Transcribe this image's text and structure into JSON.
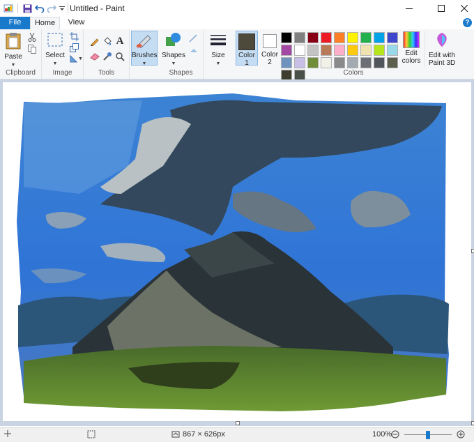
{
  "window": {
    "title": "Untitled - Paint"
  },
  "tabs": {
    "file": "File",
    "home": "Home",
    "view": "View"
  },
  "ribbon": {
    "clipboard": {
      "paste": "Paste",
      "group": "Clipboard"
    },
    "image": {
      "select": "Select",
      "group": "Image"
    },
    "tools": {
      "group": "Tools",
      "text_glyph": "A"
    },
    "brushes": {
      "label": "Brushes"
    },
    "shapes": {
      "label": "Shapes",
      "group": "Shapes"
    },
    "size": {
      "label": "Size"
    },
    "colors": {
      "color1_line1": "Color",
      "color1_line2": "1",
      "color2_line1": "Color",
      "color2_line2": "2",
      "edit_line1": "Edit",
      "edit_line2": "colors",
      "paint3d_line1": "Edit with",
      "paint3d_line2": "Paint 3D",
      "group": "Colors",
      "color1_value": "#4d4a3b",
      "color2_value": "#ffffff",
      "palette": [
        "#000000",
        "#7f7f7f",
        "#880015",
        "#ed1c24",
        "#ff7f27",
        "#fff200",
        "#22b14c",
        "#00a2e8",
        "#3f48cc",
        "#a349a4",
        "#ffffff",
        "#c3c3c3",
        "#b97a57",
        "#ffaec9",
        "#ffc90e",
        "#efe4b0",
        "#b5e61d",
        "#99d9ea",
        "#7092be",
        "#c8bfe7",
        "#708e3a",
        "#f2f1e8",
        "#8a8a8a",
        "#a4aab2",
        "#6c6f75",
        "#51565c",
        "#5c5f4e",
        "#3d3c2d",
        "#485048"
      ]
    }
  },
  "status": {
    "dimensions": "867 × 626px",
    "zoom": "100%",
    "zoom_level": 100
  }
}
